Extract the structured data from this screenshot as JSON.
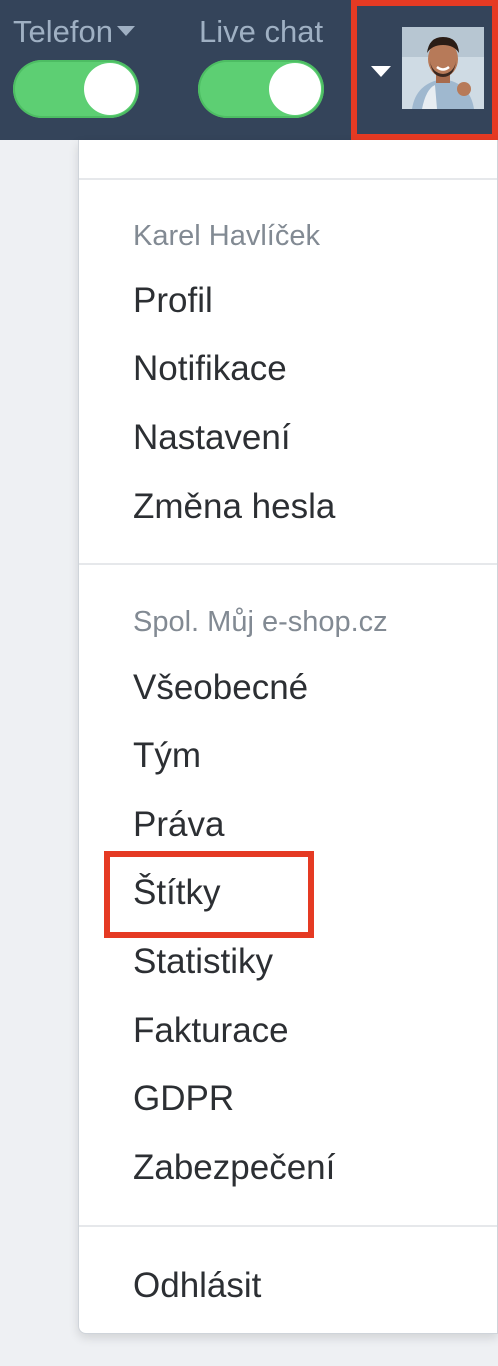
{
  "topbar": {
    "phone": {
      "label": "Telefon",
      "enabled": true
    },
    "livechat": {
      "label": "Live chat",
      "enabled": true
    },
    "user_menu": {
      "avatar_icon": "user-photo"
    }
  },
  "dropdown": {
    "user_section": {
      "header": "Karel Havlíček",
      "items": [
        "Profil",
        "Notifikace",
        "Nastavení",
        "Změna hesla"
      ]
    },
    "company_section": {
      "header": "Spol. Můj e-shop.cz",
      "items": [
        "Všeobecné",
        "Tým",
        "Práva",
        "Štítky",
        "Statistiky",
        "Fakturace",
        "GDPR",
        "Zabezpečení"
      ]
    },
    "logout_label": "Odhlásit"
  },
  "colors": {
    "topbar": "#34445a",
    "toggle_on": "#5dcf73",
    "highlight": "#e53a23"
  }
}
